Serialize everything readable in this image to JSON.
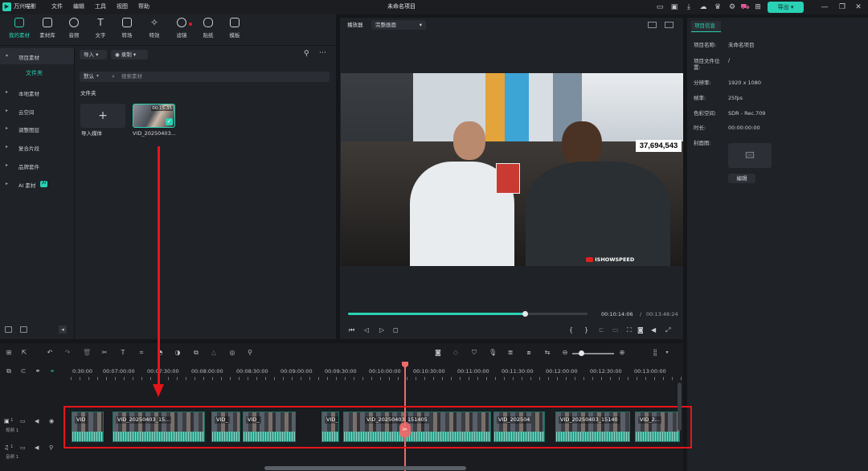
{
  "app": {
    "title": "万兴喵影",
    "project_title": "未命名项目"
  },
  "menu": [
    "文件",
    "编辑",
    "工具",
    "视图",
    "帮助"
  ],
  "export_label": "导出",
  "toolbar": [
    {
      "label": "我的素材",
      "icon": "media-icon"
    },
    {
      "label": "素材库",
      "icon": "library-icon"
    },
    {
      "label": "音频",
      "icon": "audio-icon"
    },
    {
      "label": "文字",
      "icon": "text-icon"
    },
    {
      "label": "转场",
      "icon": "transition-icon"
    },
    {
      "label": "特效",
      "icon": "effects-icon"
    },
    {
      "label": "滤镜",
      "icon": "filter-icon"
    },
    {
      "label": "贴纸",
      "icon": "sticker-icon"
    },
    {
      "label": "模板",
      "icon": "template-icon"
    }
  ],
  "sidebar": {
    "project_media": "项目素材",
    "folder": "文件夹",
    "items": [
      "本地素材",
      "云空间",
      "调整图层",
      "复合片段",
      "品牌套件",
      "AI 素材"
    ],
    "ai_badge": "AI"
  },
  "media": {
    "import_label": "导入",
    "record_label": "录制",
    "sort_label": "默认",
    "search_placeholder": "搜索素材",
    "folder_label": "文件夹",
    "import_media_label": "导入媒体",
    "clip_name": "VID_20250403...",
    "clip_duration": "00:15:35"
  },
  "player": {
    "label": "播放器",
    "quality": "完整画面",
    "current_time": "00:10:14:06",
    "separator": "/",
    "total_time": "00:13:48:24",
    "progress": 0.74,
    "overlay_count": "37,694,543",
    "channel_tag": "ISHOWSPEED"
  },
  "properties": {
    "tab": "项目信息",
    "rows": [
      {
        "label": "项目名称:",
        "value": "未命名项目"
      },
      {
        "label": "项目文件位置:",
        "value": "/"
      },
      {
        "label": "分辨率:",
        "value": "1920 x 1080"
      },
      {
        "label": "帧率:",
        "value": "25fps"
      },
      {
        "label": "色彩空间:",
        "value": "SDR - Rec.709"
      },
      {
        "label": "时长:",
        "value": "00:00:00:00"
      }
    ],
    "cover_label": "封面图:",
    "edit_label": "编辑"
  },
  "timeline": {
    "ruler": [
      "0:30:00",
      "00:07:00:00",
      "00:07:30:00",
      "00:08:00:00",
      "00:08:30:00",
      "00:09:00:00",
      "00:09:30:00",
      "00:10:00:00",
      "00:10:30:00",
      "00:11:00:00",
      "00:11:30:00",
      "00:12:00:00",
      "00:12:30:00",
      "00:13:00:00"
    ],
    "video_track_label": "视频 1",
    "audio_track_label": "音频 1",
    "clips": [
      "VID",
      "VID_20250403_15...",
      "VID_",
      "VID_",
      "VID_",
      "VID_20250403_151405",
      "VID_202504",
      "VID_20250403_15140",
      "VID_2..."
    ]
  },
  "colors": {
    "accent": "#2ad1b4",
    "annotation": "#e8141b",
    "playhead": "#f06a6a"
  }
}
